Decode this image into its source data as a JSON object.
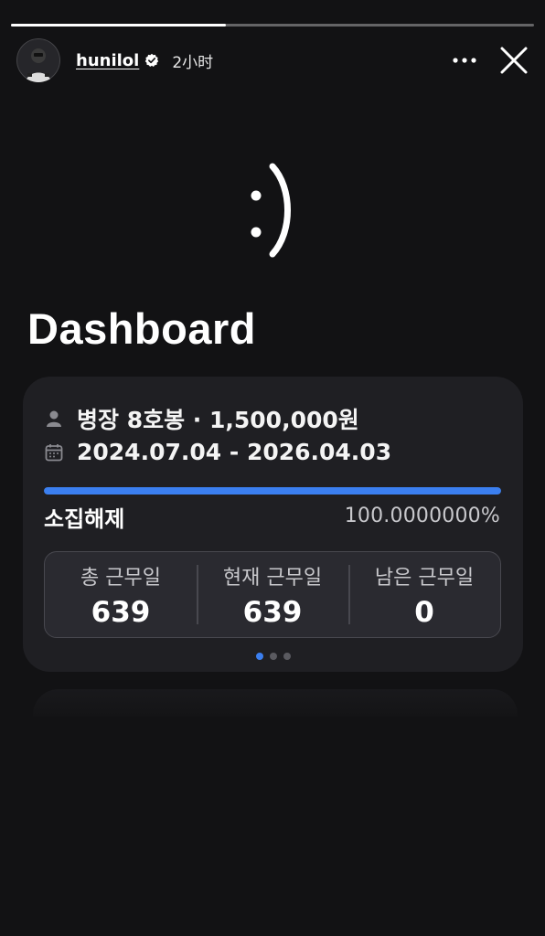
{
  "story": {
    "progress": 0.41,
    "username": "hunilol",
    "time": "2小时"
  },
  "content": {
    "emoticon": ":)",
    "title": "Dashboard"
  },
  "card": {
    "rank_line": "병장 8호봉 · 1,500,000원",
    "date_range": "2024.07.04 - 2026.04.03",
    "progress_ratio": 1.0,
    "status_label": "소집해제",
    "percent": "100.0000000%",
    "stats": [
      {
        "label": "총 근무일",
        "value": "639"
      },
      {
        "label": "현재 근무일",
        "value": "639"
      },
      {
        "label": "남은 근무일",
        "value": "0"
      }
    ],
    "pagination": {
      "count": 3,
      "active": 0
    }
  },
  "colors": {
    "accent": "#3b7ff0",
    "background": "#121214",
    "card": "#1f1f23"
  },
  "icons": {
    "user": "person-icon",
    "calendar": "calendar-icon",
    "verified": "verified-badge-icon",
    "more": "more-dots-icon",
    "close": "close-icon"
  }
}
